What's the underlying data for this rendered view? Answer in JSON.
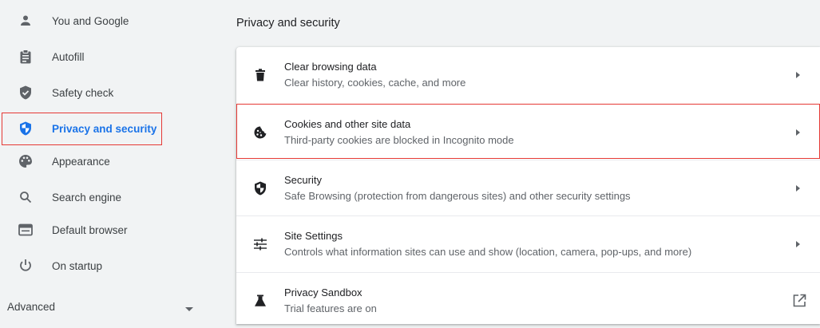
{
  "sidebar": {
    "items": [
      {
        "label": "You and Google",
        "icon": "person-icon"
      },
      {
        "label": "Autofill",
        "icon": "clipboard-icon"
      },
      {
        "label": "Safety check",
        "icon": "shield-check-icon"
      },
      {
        "label": "Privacy and security",
        "icon": "shield-privacy-icon",
        "active": true
      },
      {
        "label": "Appearance",
        "icon": "palette-icon"
      },
      {
        "label": "Search engine",
        "icon": "search-icon"
      },
      {
        "label": "Default browser",
        "icon": "browser-window-icon"
      },
      {
        "label": "On startup",
        "icon": "power-icon"
      }
    ],
    "advanced_label": "Advanced"
  },
  "main": {
    "section_title": "Privacy and security",
    "rows": [
      {
        "title": "Clear browsing data",
        "subtitle": "Clear history, cookies, cache, and more",
        "icon": "trash-icon"
      },
      {
        "title": "Cookies and other site data",
        "subtitle": "Third-party cookies are blocked in Incognito mode",
        "icon": "cookie-icon"
      },
      {
        "title": "Security",
        "subtitle": "Safe Browsing (protection from dangerous sites) and other security settings",
        "icon": "shield-icon"
      },
      {
        "title": "Site Settings",
        "subtitle": "Controls what information sites can use and show (location, camera, pop-ups, and more)",
        "icon": "tune-icon"
      },
      {
        "title": "Privacy Sandbox",
        "subtitle": "Trial features are on",
        "icon": "flask-icon"
      }
    ]
  },
  "colors": {
    "accent": "#1a73e8",
    "highlight": "#e53935",
    "icon": "#5f6368"
  }
}
